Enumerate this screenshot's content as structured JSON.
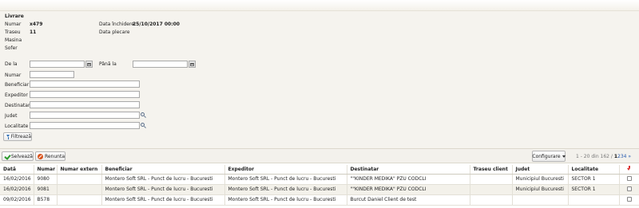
{
  "info": {
    "title": "Livrare",
    "numar_label": "Numar",
    "numar_value": "x479",
    "traseu_label": "Traseu",
    "traseu_value": "11",
    "masina_label": "Masina",
    "sofer_label": "Sofer",
    "data_inchidere_label": "Data închidere",
    "data_inchidere_value": "25/10/2017 00:00",
    "data_plecare_label": "Data plecare"
  },
  "filters": {
    "de_la": "De la",
    "pana_la": "Până la",
    "numar": "Numar",
    "beneficiar": "Beneficiar",
    "expeditor": "Expeditor",
    "destinatar": "Destinatar",
    "judet": "Judet",
    "localitate": "Localitate",
    "filter_button": "Filtrează"
  },
  "toolbar": {
    "save_label": "Selvează",
    "cancel_label": "Renunta",
    "config_label": "Configurare",
    "pager_text": "1 - 20 din 162 /",
    "pages": [
      "1",
      "2",
      "3",
      "4",
      "»"
    ]
  },
  "grid": {
    "columns": [
      "Dată",
      "Numar",
      "Numar extern",
      "Beneficiar",
      "Expeditor",
      "Destinatar",
      "Traseu client",
      "Judet",
      "Localitate"
    ],
    "rows": [
      [
        "16/02/2016",
        "9080",
        "",
        "Montero Soft SRL - Punct de lucru - Bucuresti",
        "Montero Soft SRL - Punct de lucru - Bucuresti",
        "\"\"KINDER MEDIKA\" PZU CODCLI",
        "",
        "Municipiul Bucuresti",
        "SECTOR 1"
      ],
      [
        "16/02/2016",
        "9081",
        "",
        "Montero Soft SRL - Punct de lucru - Bucuresti",
        "Montero Soft SRL - Punct de lucru - Bucuresti",
        "\"\"KINDER MEDIKA\" PZU CODCLI",
        "",
        "Municipiul Bucuresti",
        "SECTOR 1"
      ],
      [
        "09/02/2016",
        "B578",
        "",
        "Montero Soft SRL - Punct de lucru - Bucuresti",
        "Montero Soft SRL - Punct de lucru - Bucuresti",
        "Burcut Daniel Client de test",
        "",
        "",
        ""
      ]
    ]
  }
}
